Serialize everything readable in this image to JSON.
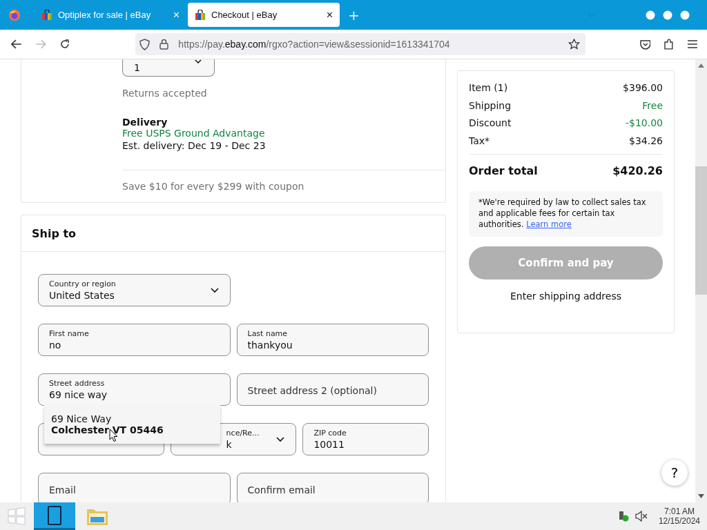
{
  "browser": {
    "tabs": [
      {
        "title": "Optiplex for sale | eBay",
        "close": "×",
        "selected": false
      },
      {
        "title": "Checkout | eBay",
        "close": "×",
        "selected": true
      }
    ],
    "new_tab": "+",
    "url": {
      "prefix": "https://pay.",
      "domain": "ebay.com",
      "path": "/rgxo?action=view&sessionid=1613341704"
    }
  },
  "item": {
    "quantity": "1",
    "returns": "Returns accepted",
    "delivery_title": "Delivery",
    "delivery_method": "Free USPS Ground Advantage",
    "estimate": "Est. delivery: Dec 19 - Dec 23",
    "coupon": "Save $10 for every $299 with coupon"
  },
  "ship_to": {
    "title": "Ship to",
    "rows": [
      [
        {
          "kind": "select",
          "label": "Country or region",
          "value": "United States"
        }
      ],
      [
        {
          "kind": "text",
          "label": "First name",
          "value": "no"
        },
        {
          "kind": "text",
          "label": "Last name",
          "value": "thankyou"
        }
      ],
      [
        {
          "kind": "text",
          "label": "Street address",
          "value": "69 nice way"
        },
        {
          "kind": "text",
          "placeholder": "Street address 2 (optional)"
        }
      ],
      [
        {
          "kind": "blank"
        },
        {
          "kind": "select",
          "label": "nce/Re...",
          "value": "k"
        },
        {
          "kind": "text",
          "label": "ZIP code",
          "value": "10011"
        }
      ],
      [
        {
          "kind": "text",
          "placeholder": "Email"
        },
        {
          "kind": "text",
          "placeholder": "Confirm email"
        }
      ]
    ],
    "suggestion": {
      "line1": "69 Nice Way",
      "line2": "Colchester VT 05446"
    }
  },
  "summary": {
    "lines": [
      {
        "label": "Item (1)",
        "value": "$396.00",
        "color": "#111111"
      },
      {
        "label": "Shipping",
        "value": "Free",
        "color": "#118540"
      },
      {
        "label": "Discount",
        "value": "-$10.00",
        "color": "#118540"
      },
      {
        "label": "Tax*",
        "value": "$34.26",
        "color": "#111111"
      }
    ],
    "total_label": "Order total",
    "total_value": "$420.26",
    "note": "*We're required by law to collect sales tax and applicable fees for certain tax authorities.",
    "note_link": "Learn more",
    "confirm": {
      "label": "Confirm and pay",
      "disabled": true
    },
    "hint": "Enter shipping address"
  },
  "help": "?",
  "taskbar": {
    "time": "7:01 AM",
    "date": "12/15/2024"
  }
}
